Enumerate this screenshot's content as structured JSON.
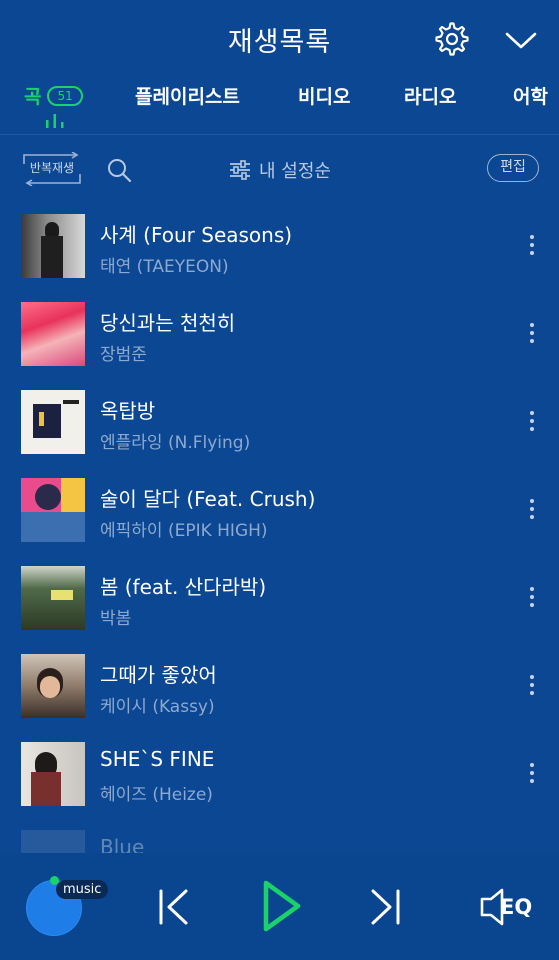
{
  "header": {
    "title": "재생목록",
    "settings_icon": "gear-icon",
    "collapse_icon": "chevron-down-icon"
  },
  "tabs": [
    {
      "label": "곡",
      "count": "51",
      "active": true
    },
    {
      "label": "플레이리스트"
    },
    {
      "label": "비디오"
    },
    {
      "label": "라디오"
    },
    {
      "label": "어학"
    }
  ],
  "toolbar": {
    "repeat_label": "반복재생",
    "sort_label": "내 설정순",
    "edit_label": "편집"
  },
  "songs": [
    {
      "title": "사계 (Four Seasons)",
      "artist": "태연 (TAEYEON)"
    },
    {
      "title": "당신과는 천천히",
      "artist": "장범준"
    },
    {
      "title": "옥탑방",
      "artist": "엔플라잉 (N.Flying)"
    },
    {
      "title": "술이 달다 (Feat. Crush)",
      "artist": "에픽하이 (EPIK HIGH)"
    },
    {
      "title": "봄 (feat. 산다라박)",
      "artist": "박봄"
    },
    {
      "title": "그때가 좋았어",
      "artist": "케이시 (Kassy)"
    },
    {
      "title": "SHE`S FINE",
      "artist": "헤이즈 (Heize)"
    },
    {
      "title": "Blue",
      "artist": ""
    }
  ],
  "player": {
    "tag": "music",
    "eq_label": "EQ"
  },
  "colors": {
    "background": "#0b4792",
    "accent": "#19d36a",
    "subtext": "#8ea9cf"
  }
}
